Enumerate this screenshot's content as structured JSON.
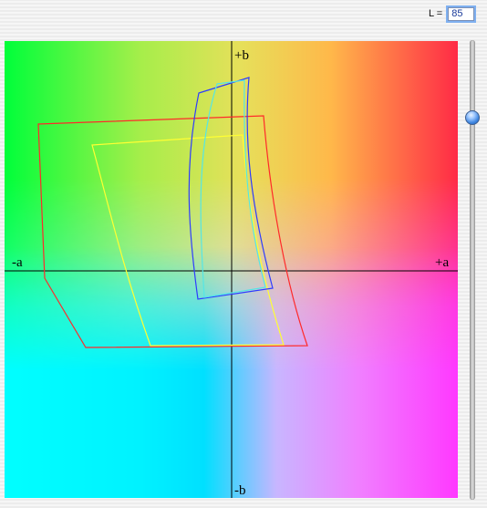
{
  "lightness": {
    "label": "L =",
    "value": "85",
    "fraction": 0.85
  },
  "axes": {
    "plus_b": "+b",
    "minus_b": "-b",
    "plus_a": "+a",
    "minus_a": "-a"
  },
  "colors": {
    "gamut_red": "#ff2a2a",
    "gamut_yellow": "#ffff33",
    "gamut_blue": "#2e3cff",
    "gamut_cyan": "#55e6e6",
    "axis": "#000000"
  },
  "icons": {
    "slider_knob": "aqua-knob-icon"
  }
}
